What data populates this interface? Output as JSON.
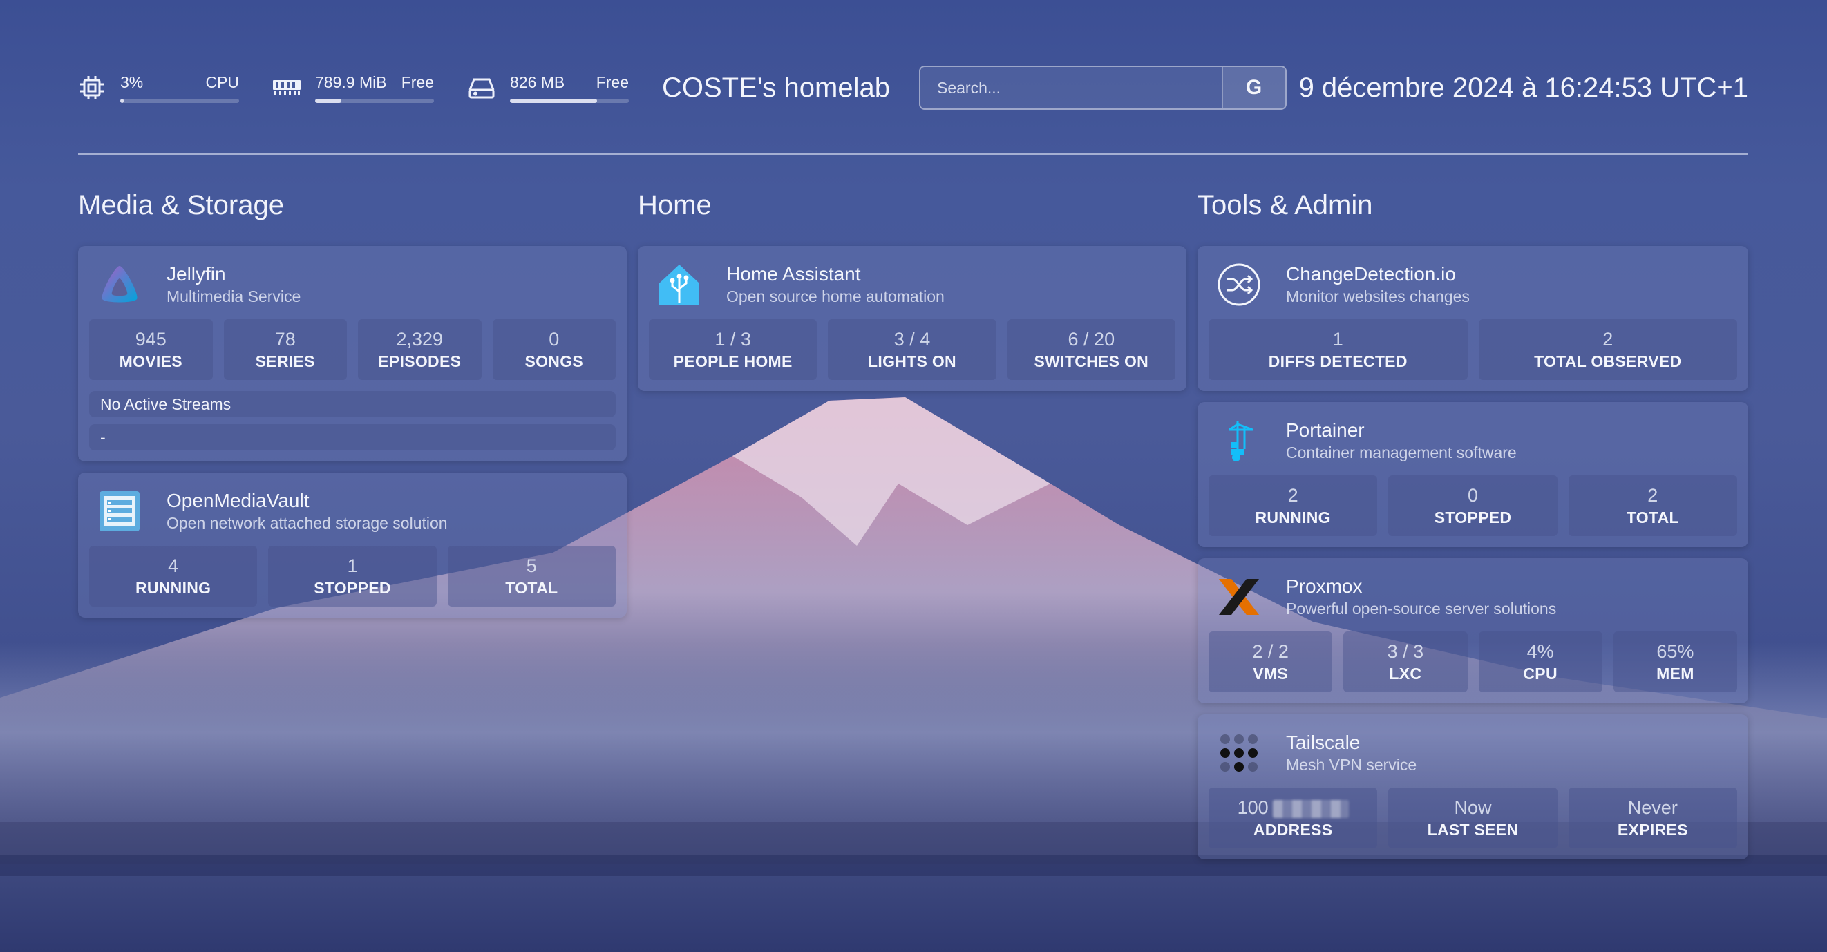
{
  "header": {
    "cpu": {
      "value": "3%",
      "label": "CPU",
      "percent": 3
    },
    "memory": {
      "value": "789.9 MiB",
      "label": "Free",
      "percent": 22
    },
    "disk": {
      "value": "826 MB",
      "label": "Free",
      "percent": 73
    },
    "title": "COSTE's homelab",
    "search": {
      "placeholder": "Search...",
      "engine_label": "G"
    },
    "datetime": "9 décembre 2024 à 16:24:53 UTC+1"
  },
  "columns": [
    {
      "title": "Media & Storage"
    },
    {
      "title": "Home"
    },
    {
      "title": "Tools & Admin"
    }
  ],
  "services": {
    "jellyfin": {
      "name": "Jellyfin",
      "description": "Multimedia Service",
      "stats": [
        {
          "value": "945",
          "label": "MOVIES"
        },
        {
          "value": "78",
          "label": "SERIES"
        },
        {
          "value": "2,329",
          "label": "EPISODES"
        },
        {
          "value": "0",
          "label": "SONGS"
        }
      ],
      "streams_title": "No Active Streams",
      "streams_value": "-"
    },
    "omv": {
      "name": "OpenMediaVault",
      "description": "Open network attached storage solution",
      "stats": [
        {
          "value": "4",
          "label": "RUNNING"
        },
        {
          "value": "1",
          "label": "STOPPED"
        },
        {
          "value": "5",
          "label": "TOTAL"
        }
      ]
    },
    "homeassistant": {
      "name": "Home Assistant",
      "description": "Open source home automation",
      "stats": [
        {
          "value": "1 / 3",
          "label": "PEOPLE HOME"
        },
        {
          "value": "3 / 4",
          "label": "LIGHTS ON"
        },
        {
          "value": "6 / 20",
          "label": "SWITCHES ON"
        }
      ]
    },
    "changedetection": {
      "name": "ChangeDetection.io",
      "description": "Monitor websites changes",
      "stats": [
        {
          "value": "1",
          "label": "DIFFS DETECTED"
        },
        {
          "value": "2",
          "label": "TOTAL OBSERVED"
        }
      ]
    },
    "portainer": {
      "name": "Portainer",
      "description": "Container management software",
      "stats": [
        {
          "value": "2",
          "label": "RUNNING"
        },
        {
          "value": "0",
          "label": "STOPPED"
        },
        {
          "value": "2",
          "label": "TOTAL"
        }
      ]
    },
    "proxmox": {
      "name": "Proxmox",
      "description": "Powerful open-source server solutions",
      "stats": [
        {
          "value": "2 / 2",
          "label": "VMS"
        },
        {
          "value": "3 / 3",
          "label": "LXC"
        },
        {
          "value": "4%",
          "label": "CPU"
        },
        {
          "value": "65%",
          "label": "MEM"
        }
      ]
    },
    "tailscale": {
      "name": "Tailscale",
      "description": "Mesh VPN service",
      "stats": [
        {
          "value": "100",
          "label": "ADDRESS"
        },
        {
          "value": "Now",
          "label": "LAST SEEN"
        },
        {
          "value": "Never",
          "label": "EXPIRES"
        }
      ]
    }
  },
  "icons": {
    "cpu": "cpu-chip-icon",
    "memory": "memory-icon",
    "disk": "hard-drive-icon",
    "jellyfin": "jellyfin-logo-icon",
    "omv": "openmediavault-logo-icon",
    "homeassistant": "home-assistant-logo-icon",
    "changedetection": "changedetection-logo-icon",
    "portainer": "portainer-logo-icon",
    "proxmox": "proxmox-logo-icon",
    "tailscale": "tailscale-logo-icon"
  },
  "colors": {
    "background": "#46599b",
    "card": "#7884be",
    "jellyfin": "#aa5cc3",
    "homeassistant": "#41bdf5",
    "proxmox": "#e57000",
    "omv": "#5dacdf"
  }
}
